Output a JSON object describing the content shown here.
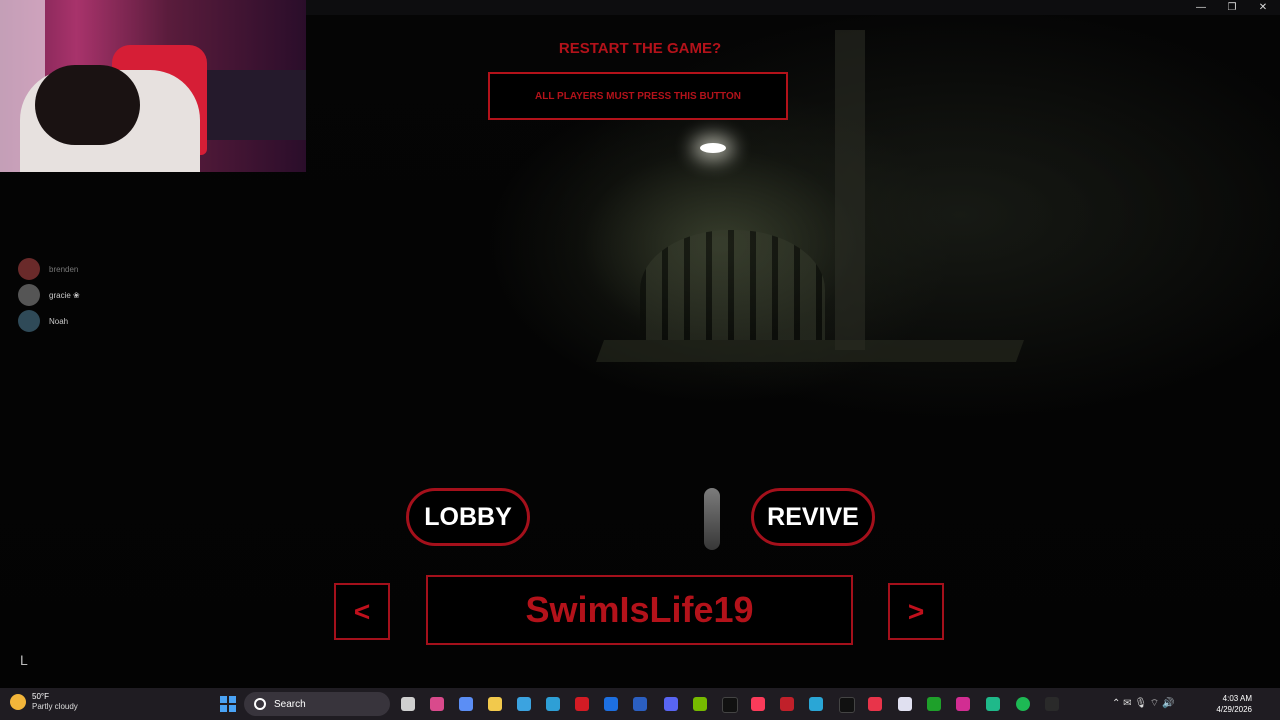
{
  "window": {
    "minimize": "—",
    "restore": "❐",
    "close": "✕"
  },
  "players": [
    {
      "name": "brenden"
    },
    {
      "name": "gracie ❀"
    },
    {
      "name": "Noah"
    }
  ],
  "restart": {
    "title": "RESTART THE GAME?",
    "button_label": "ALL PLAYERS MUST PRESS THIS BUTTON"
  },
  "actions": {
    "lobby_label": "LOBBY",
    "revive_label": "REVIVE"
  },
  "spectate": {
    "prev_label": "<",
    "next_label": ">",
    "player_name": "SwimIsLife19"
  },
  "cursor_glyph": "L",
  "taskbar": {
    "weather_temp": "50°F",
    "weather_desc": "Partly cloudy",
    "search_label": "Search",
    "time": "4:03 AM",
    "date": "4/29/2026",
    "tray_icons": "⌃  ✉  🎙  ⌔  🔊"
  },
  "colors": {
    "accent": "#b3121a",
    "taskbar": "#1f1c22"
  }
}
